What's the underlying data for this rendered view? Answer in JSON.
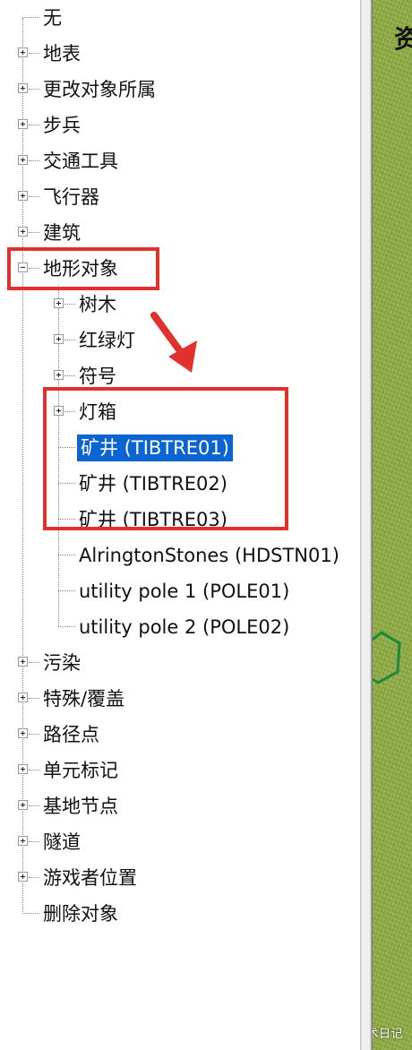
{
  "tree": {
    "root_items": [
      {
        "label": "无",
        "expandable": false
      },
      {
        "label": "地表",
        "expandable": true
      },
      {
        "label": "更改对象所属",
        "expandable": true
      },
      {
        "label": "步兵",
        "expandable": true
      },
      {
        "label": "交通工具",
        "expandable": true
      },
      {
        "label": "飞行器",
        "expandable": true
      },
      {
        "label": "建筑",
        "expandable": true
      },
      {
        "label": "地形对象",
        "expandable": true,
        "expanded": true
      }
    ],
    "terrain_children": [
      {
        "label": "树木",
        "expandable": true
      },
      {
        "label": "红绿灯",
        "expandable": true
      },
      {
        "label": "符号",
        "expandable": true
      },
      {
        "label": "灯箱",
        "expandable": true
      },
      {
        "label": "矿井 (TIBTRE01)",
        "expandable": false,
        "selected": true
      },
      {
        "label": "矿井 (TIBTRE02)",
        "expandable": false
      },
      {
        "label": "矿井 (TIBTRE03)",
        "expandable": false
      },
      {
        "label": "AlringtonStones (HDSTN01)",
        "expandable": false
      },
      {
        "label": "utility pole 1 (POLE01)",
        "expandable": false
      },
      {
        "label": "utility pole 2 (POLE02)",
        "expandable": false
      }
    ],
    "root_items_after": [
      {
        "label": "污染",
        "expandable": true
      },
      {
        "label": "特殊/覆盖",
        "expandable": true
      },
      {
        "label": "路径点",
        "expandable": true
      },
      {
        "label": "单元标记",
        "expandable": true
      },
      {
        "label": "基地节点",
        "expandable": true
      },
      {
        "label": "隧道",
        "expandable": true
      },
      {
        "label": "游戏者位置",
        "expandable": true
      },
      {
        "label": "删除对象",
        "expandable": false
      }
    ]
  },
  "map": {
    "title_fragment": "资"
  },
  "annotations": {
    "box_color": "#e0312d",
    "arrow_color": "#e0312d"
  },
  "watermark": "头条 @艺术日记",
  "colors": {
    "selection": "#0a64d2",
    "grass": "#8da943"
  }
}
